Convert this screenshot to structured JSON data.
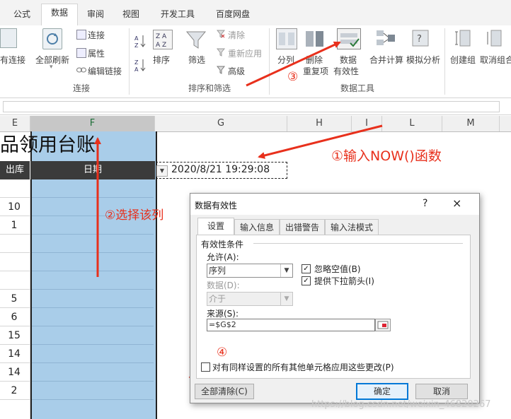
{
  "ribbon": {
    "tabs": [
      {
        "label": "公式",
        "active": false
      },
      {
        "label": "数据",
        "active": true
      },
      {
        "label": "审阅",
        "active": false
      },
      {
        "label": "视图",
        "active": false
      },
      {
        "label": "开发工具",
        "active": false
      },
      {
        "label": "百度网盘",
        "active": false
      }
    ],
    "connections": {
      "existing": "有连接",
      "refresh_all": "全部刷新",
      "connections": "连接",
      "properties": "属性",
      "edit_links": "编辑链接",
      "group_label": "连接"
    },
    "sort_filter": {
      "sort": "排序",
      "filter": "筛选",
      "clear": "清除",
      "reapply": "重新应用",
      "advanced": "高级",
      "group_label": "排序和筛选"
    },
    "data_tools": {
      "text_to_columns": "分列",
      "remove_duplicates_1": "删除",
      "remove_duplicates_2": "重复项",
      "data_validation_1": "数据",
      "data_validation_2": "有效性",
      "consolidate": "合并计算",
      "what_if": "模拟分析",
      "group_label": "数据工具"
    },
    "outline": {
      "group": "创建组",
      "ungroup": "取消组合"
    }
  },
  "sheet": {
    "columns": [
      "E",
      "F",
      "G",
      "H",
      "I",
      "L",
      "M"
    ],
    "selected_column": "F",
    "title_fragment": "品领用台账",
    "header_out": "出库",
    "header_date": "日期",
    "g2_value": "2020/8/21 19:29:08",
    "out_values": [
      "",
      "10",
      "1",
      "",
      "",
      "",
      "5",
      "6",
      "15",
      "14",
      "14",
      "2"
    ]
  },
  "dialog": {
    "title": "数据有效性",
    "help": "?",
    "close": "×",
    "tabs": [
      "设置",
      "输入信息",
      "出错警告",
      "输入法模式"
    ],
    "criteria_label": "有效性条件",
    "allow_label": "允许(A):",
    "allow_value": "序列",
    "data_label": "数据(D):",
    "data_value": "介于",
    "ignore_blank": "忽略空值(B)",
    "in_cell_dropdown": "提供下拉箭头(I)",
    "source_label": "来源(S):",
    "source_value": "=$G$2",
    "apply_all": "对有同样设置的所有其他单元格应用这些更改(P)",
    "clear_all": "全部清除(C)",
    "ok": "确定",
    "cancel": "取消"
  },
  "annotations": {
    "step1": "①输入NOW()函数",
    "step2": "②选择该列",
    "step3": "③",
    "step4": "④"
  },
  "watermark": "https://blog.csdn.net/weixin_46820267",
  "colors": {
    "accent": "#217346",
    "selection": "#a9cde9",
    "annotation": "#e8301c",
    "header_dark": "#3b3b3b"
  }
}
